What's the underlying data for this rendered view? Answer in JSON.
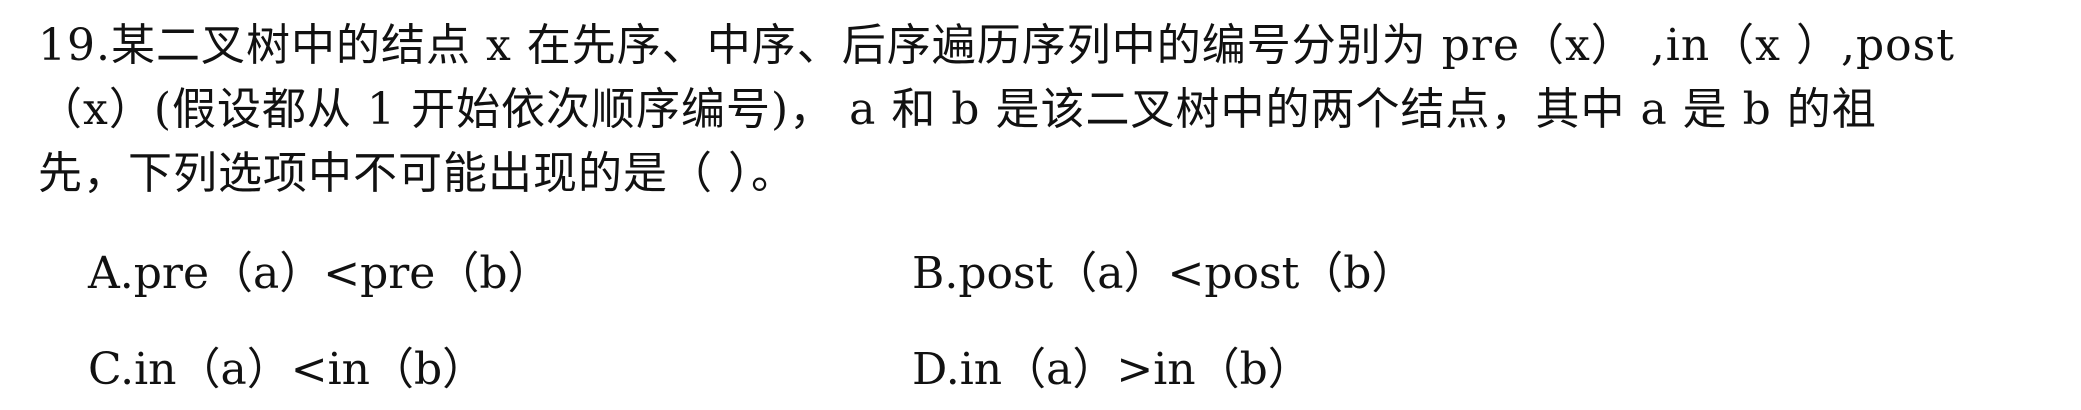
{
  "question": {
    "line1": "19.某二叉树中的结点 x 在先序、中序、后序遍历序列中的编号分别为 pre（x） ,in（x ）,post",
    "line2": "（x）(假设都从 1 开始依次顺序编号)， a 和 b 是该二叉树中的两个结点，其中 a 是 b 的祖",
    "line3": "先，下列选项中不可能出现的是（     ）。"
  },
  "options": {
    "a": "A.pre（a）<pre（b）",
    "b": "B.post（a）<post（b）",
    "c": "C.in（a）<in（b）",
    "d": "D.in（a）>in（b）"
  }
}
